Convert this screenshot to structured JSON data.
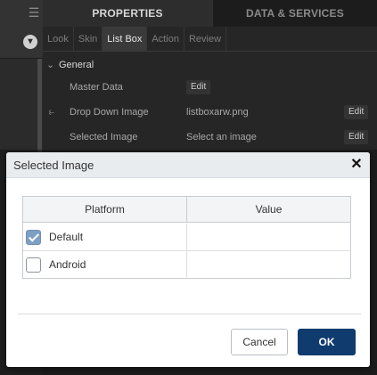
{
  "panel": {
    "top_tabs": [
      "PROPERTIES",
      "DATA & SERVICES"
    ],
    "sub_tabs": [
      "Look",
      "Skin",
      "List Box",
      "Action",
      "Review"
    ],
    "section": "General",
    "rows": [
      {
        "label": "Master Data",
        "value": "",
        "button": "Edit"
      },
      {
        "label": "Drop Down Image",
        "value": "listboxarw.png",
        "button": "Edit"
      },
      {
        "label": "Selected Image",
        "value": "Select an image",
        "button": "Edit"
      }
    ]
  },
  "dialog": {
    "title": "Selected Image",
    "columns": [
      "Platform",
      "Value"
    ],
    "rows": [
      {
        "platform": "Default",
        "checked": true,
        "value": ""
      },
      {
        "platform": "Android",
        "checked": false,
        "value": ""
      }
    ],
    "cancel_label": "Cancel",
    "ok_label": "OK"
  },
  "colors": {
    "ok_button": "#0f3b6e",
    "checkbox_checked": "#7f9fc2",
    "panel_bg": "#262626"
  }
}
